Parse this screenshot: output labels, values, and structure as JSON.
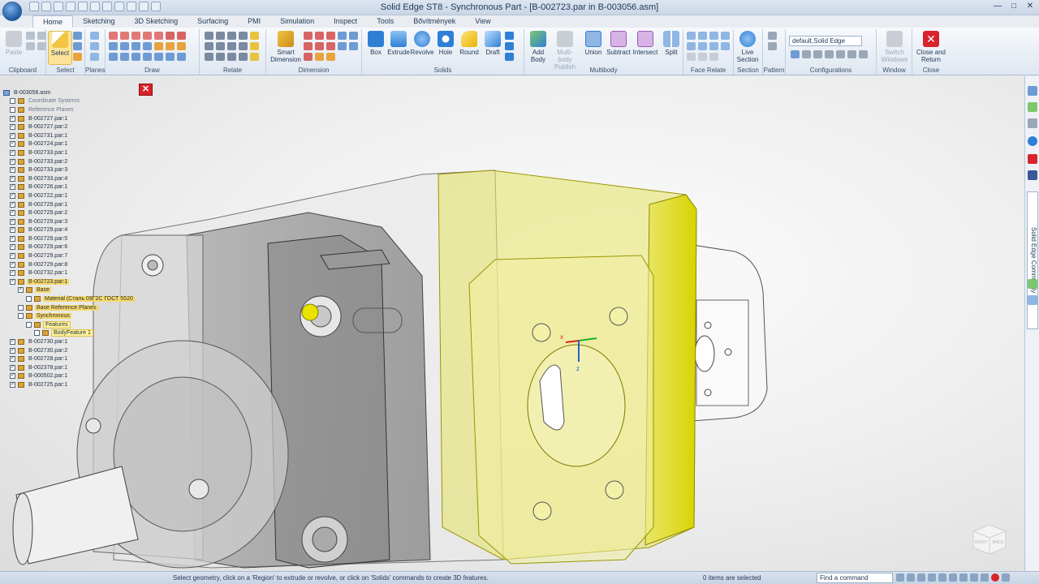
{
  "window": {
    "title": "Solid Edge ST8 - Synchronous Part - [B-002723.par in B-003056.asm]"
  },
  "tabs": [
    "Home",
    "Sketching",
    "3D Sketching",
    "Surfacing",
    "PMI",
    "Simulation",
    "Inspect",
    "Tools",
    "Bővítmények",
    "View"
  ],
  "active_tab": "Home",
  "ribbon": {
    "groups": {
      "clipboard": "Clipboard",
      "select": "Select",
      "planes": "Planes",
      "draw": "Draw",
      "relate": "Relate",
      "dimension": "Dimension",
      "solids": "Solids",
      "multibody": "Multibody",
      "face_relate": "Face Relate",
      "section": "Section",
      "pattern": "Pattern",
      "configurations": "Configurations",
      "window": "Window",
      "close": "Close"
    },
    "buttons": {
      "paste": "Paste",
      "select": "Select",
      "smart_dimension": "Smart Dimension",
      "box": "Box",
      "extrude": "Extrude",
      "revolve": "Revolve",
      "hole": "Hole",
      "round": "Round",
      "draft": "Draft",
      "add_body": "Add Body",
      "multibody_publish": "Multi-body Publish",
      "union": "Union",
      "subtract": "Subtract",
      "intersect": "Intersect",
      "split": "Split",
      "live_section": "Live Section",
      "switch_windows": "Switch Windows",
      "close_and_return": "Close and Return"
    },
    "configuration_value": "default,Solid Edge"
  },
  "tree": {
    "root": "B-003056.asm",
    "items": [
      {
        "label": "Coordinate Systems",
        "style": "dim",
        "check": false
      },
      {
        "label": "Reference Planes",
        "style": "dim",
        "check": false
      },
      {
        "label": "B-002727.par:1",
        "style": "",
        "check": true
      },
      {
        "label": "B-002727.par:2",
        "style": "",
        "check": true
      },
      {
        "label": "B-002731.par:1",
        "style": "",
        "check": true
      },
      {
        "label": "B-002724.par:1",
        "style": "",
        "check": true
      },
      {
        "label": "B-002733.par:1",
        "style": "",
        "check": true
      },
      {
        "label": "B-002733.par:2",
        "style": "",
        "check": true
      },
      {
        "label": "B-002733.par:3",
        "style": "",
        "check": true
      },
      {
        "label": "B-002733.par:4",
        "style": "",
        "check": true
      },
      {
        "label": "B-002726.par:1",
        "style": "",
        "check": true
      },
      {
        "label": "B-002722.par:1",
        "style": "",
        "check": true
      },
      {
        "label": "B-002729.par:1",
        "style": "",
        "check": true
      },
      {
        "label": "B-002729.par:2",
        "style": "",
        "check": true
      },
      {
        "label": "B-002729.par:3",
        "style": "",
        "check": true
      },
      {
        "label": "B-002729.par:4",
        "style": "",
        "check": true
      },
      {
        "label": "B-002729.par:5",
        "style": "",
        "check": true
      },
      {
        "label": "B-002729.par:6",
        "style": "",
        "check": true
      },
      {
        "label": "B-002729.par:7",
        "style": "",
        "check": true
      },
      {
        "label": "B-002729.par:8",
        "style": "",
        "check": true
      },
      {
        "label": "B-002732.par:1",
        "style": "",
        "check": true
      },
      {
        "label": "B-002723.par:1",
        "style": "hl",
        "check": true
      },
      {
        "label": "Base",
        "style": "hl",
        "check": true,
        "indent": 1
      },
      {
        "label": "Material (Сталь 09Г2С ГОСТ 5520",
        "style": "hl",
        "check": false,
        "indent": 2
      },
      {
        "label": "Base Reference Planes",
        "style": "hl",
        "check": false,
        "indent": 1
      },
      {
        "label": "Synchronous",
        "style": "hl",
        "check": false,
        "indent": 1
      },
      {
        "label": "Features",
        "style": "sel",
        "check": false,
        "indent": 2
      },
      {
        "label": "BodyFeature 1",
        "style": "sel",
        "check": false,
        "indent": 3
      },
      {
        "label": "B-002730.par:1",
        "style": "",
        "check": true
      },
      {
        "label": "B-002730.par:2",
        "style": "",
        "check": true
      },
      {
        "label": "B-002728.par:1",
        "style": "",
        "check": true
      },
      {
        "label": "B-002378.par:1",
        "style": "",
        "check": true
      },
      {
        "label": "B-000502.par:1",
        "style": "",
        "check": true
      },
      {
        "label": "B-002725.par:1",
        "style": "",
        "check": true
      }
    ]
  },
  "rail": {
    "community_label": "Solid Edge Community"
  },
  "viewcube": {
    "left_face": "RIGHT",
    "right_face": "BACK"
  },
  "status": {
    "prompt": "Select geometry, click on a 'Region' to extrude or revolve, or click on 'Solids' commands to create 3D features.",
    "selection": "0 items are selected",
    "find_command_placeholder": "Find a command"
  },
  "colors": {
    "highlight_yellow": "#d9d400",
    "ribbon_blue": "#2f7fd6",
    "close_red": "#d8232a"
  }
}
